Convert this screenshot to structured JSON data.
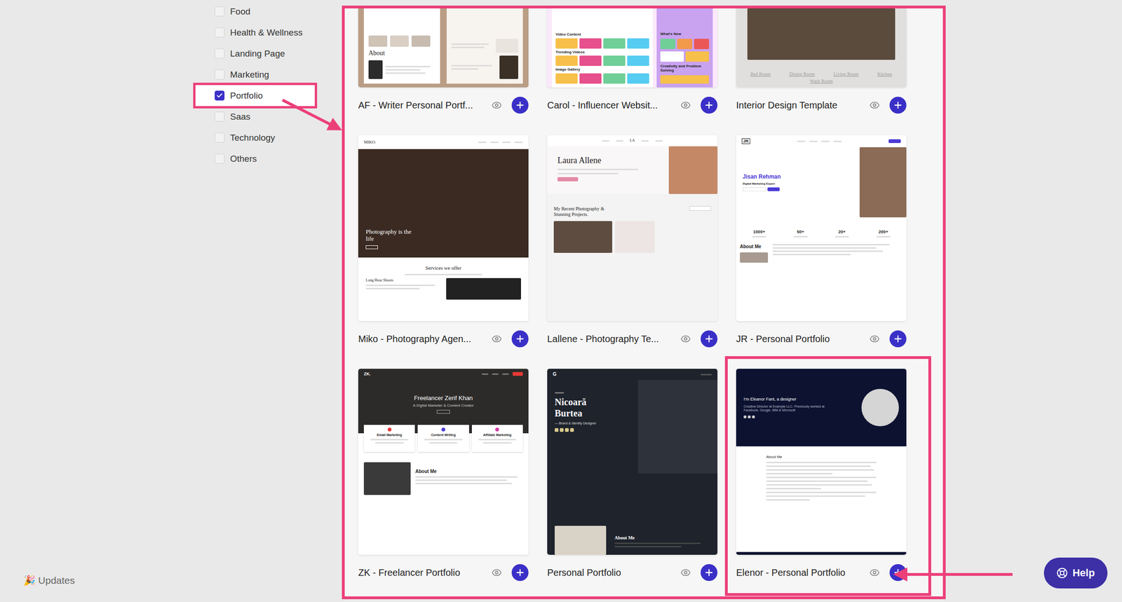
{
  "sidebar": {
    "categories": [
      {
        "label": "Food",
        "checked": false
      },
      {
        "label": "Health & Wellness",
        "checked": false
      },
      {
        "label": "Landing Page",
        "checked": false
      },
      {
        "label": "Marketing",
        "checked": false
      },
      {
        "label": "Portfolio",
        "checked": true,
        "highlighted": true
      },
      {
        "label": "Saas",
        "checked": false
      },
      {
        "label": "Technology",
        "checked": false
      },
      {
        "label": "Others",
        "checked": false
      }
    ],
    "updates": "🎉 Updates"
  },
  "templates": [
    {
      "title": "AF - Writer Personal Portf...",
      "highlighted": false,
      "preview": {
        "kind": "writer",
        "heading": "About"
      }
    },
    {
      "title": "Carol - Influencer Websit...",
      "highlighted": false,
      "preview": {
        "kind": "influencer",
        "sections": [
          "Video Content",
          "Trending Videos",
          "Image Gallery"
        ],
        "side": [
          "What's New",
          "Creativity and Problem Solving"
        ]
      }
    },
    {
      "title": "Interior Design Template",
      "highlighted": false,
      "preview": {
        "kind": "interior",
        "rooms": [
          "Bed Room",
          "Dining Room",
          "Living Room",
          "Kitchen",
          "Wash Room"
        ]
      }
    },
    {
      "title": "Miko - Photography Agen...",
      "highlighted": false,
      "preview": {
        "kind": "miko",
        "logo": "MIKO.",
        "hero": "Photography is the life",
        "section": "Services we offer",
        "service": "Long Hour Shoots"
      }
    },
    {
      "title": "Lallene - Photography Te...",
      "highlighted": false,
      "preview": {
        "kind": "lallene",
        "logo": "LA",
        "name": "Laura Allene",
        "section": "My Recent Photography & Stunning Projects."
      }
    },
    {
      "title": "JR - Personal Portfolio",
      "highlighted": false,
      "preview": {
        "kind": "jr",
        "logo": "JR",
        "name": "Jisan Rehman",
        "role": "Digital Marketing Expert",
        "stats": [
          "1000+",
          "50+",
          "20+",
          "200+"
        ],
        "section": "About Me"
      }
    },
    {
      "title": "ZK - Freelancer Portfolio",
      "highlighted": false,
      "preview": {
        "kind": "zk",
        "logo": "ZK.",
        "name": "Freelancer Zerif Khan",
        "role": "A Digital Marketer & Content Creator",
        "services": [
          "Email Marketing",
          "Content Writing",
          "Affiliate Marketing"
        ],
        "section": "About Me"
      }
    },
    {
      "title": "Personal Portfolio",
      "highlighted": false,
      "preview": {
        "kind": "nicoara",
        "logo": "G",
        "name": "Nicoară Burtea",
        "role": "— Brand & Identity Designer",
        "section": "About Me"
      }
    },
    {
      "title": "Elenor - Personal Portfolio",
      "highlighted": true,
      "preview": {
        "kind": "elenor",
        "name": "I'm Eleanor Fant, a designer",
        "bio": "Creative Director at Example LLC. Previously worked at Facebook, Google, IBM & Microsoft",
        "section": "About Me"
      }
    }
  ],
  "help": {
    "label": "Help"
  }
}
